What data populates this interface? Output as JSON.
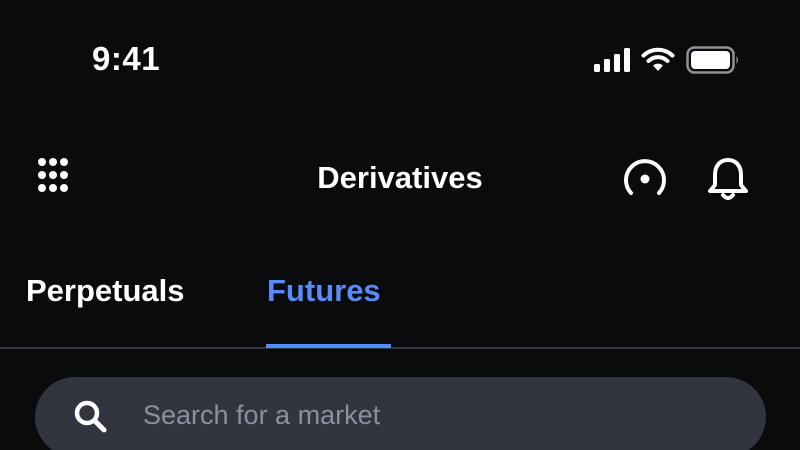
{
  "status_bar": {
    "time": "9:41",
    "icons": [
      "signal-icon",
      "wifi-icon",
      "battery-icon"
    ]
  },
  "header": {
    "title": "Derivatives",
    "left_icon": "grid-icon",
    "right_icons": [
      "gauge-icon",
      "bell-icon"
    ]
  },
  "tabs": [
    {
      "label": "Perpetuals",
      "active": false
    },
    {
      "label": "Futures",
      "active": true
    }
  ],
  "search": {
    "placeholder": "Search for a market",
    "value": "",
    "icon": "search-icon"
  },
  "colors": {
    "background": "#0a0b0d",
    "accent": "#578bfa",
    "search_background": "#32353d",
    "placeholder": "#8a919e"
  }
}
